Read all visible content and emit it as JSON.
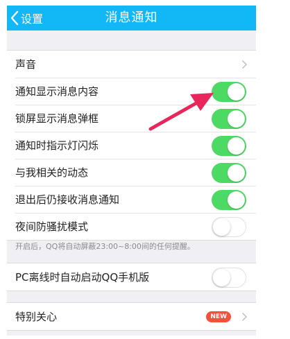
{
  "nav": {
    "back_label": "设置",
    "title": "消息通知",
    "back_icon": "chevron-left-icon"
  },
  "colors": {
    "nav_bg": "#12b7f5",
    "toggle_on": "#4cd964",
    "badge": "#f4513c",
    "annotation_arrow": "#e8265c"
  },
  "groups": [
    {
      "rows": [
        {
          "label": "声音",
          "control": "chevron"
        },
        {
          "label": "通知显示消息内容",
          "control": "toggle",
          "on": true
        },
        {
          "label": "锁屏显示消息弹框",
          "control": "toggle",
          "on": true
        },
        {
          "label": "通知时指示灯闪烁",
          "control": "toggle",
          "on": true
        },
        {
          "label": "与我相关的动态",
          "control": "toggle",
          "on": true
        },
        {
          "label": "退出后仍接收消息通知",
          "control": "toggle",
          "on": true
        },
        {
          "label": "夜间防骚扰模式",
          "control": "toggle",
          "on": false
        }
      ],
      "footer": "开启后，QQ将自动屏蔽23:00~8:00间的任何提醒。"
    },
    {
      "rows": [
        {
          "label": "PC离线时自动启动QQ手机版",
          "control": "toggle",
          "on": false
        }
      ]
    },
    {
      "rows": [
        {
          "label": "特别关心",
          "control": "chevron",
          "badge": "NEW"
        }
      ]
    }
  ]
}
